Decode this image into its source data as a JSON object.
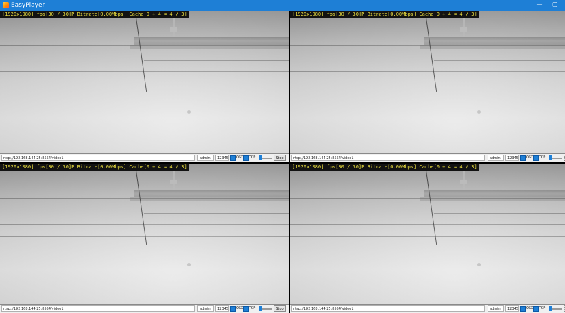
{
  "window": {
    "title": "EasyPlayer",
    "minimize_glyph": "—",
    "maximize_glyph": "▢"
  },
  "panes": [
    {
      "osd_text": "[1920x1080] fps[30 / 30]P Bitrate[0.00Mbps] Cache[0 + 4 = 4 / 3]",
      "url": "rtsp://192.168.144.25:8554/video1",
      "username": "admin",
      "password": "12345",
      "osd_label": "OSD",
      "tcp_label": "TCP",
      "stop_label": "Stop"
    },
    {
      "osd_text": "[1920x1080] fps[30 / 30]P Bitrate[0.00Mbps] Cache[0 + 4 = 4 / 3]",
      "url": "rtsp://192.168.144.25:8554/video1",
      "username": "admin",
      "password": "12345",
      "osd_label": "OSD",
      "tcp_label": "TCP",
      "stop_label": "St"
    },
    {
      "osd_text": "[1920x1080] fps[30 / 30]P Bitrate[0.00Mbps] Cache[0 + 4 = 4 / 3]",
      "url": "rtsp://192.168.144.25:8554/video1",
      "username": "admin",
      "password": "12345",
      "osd_label": "OSD",
      "tcp_label": "TCP",
      "stop_label": "Stop"
    },
    {
      "osd_text": "[1920x1080] fps[30 / 30]P Bitrate[0.00Mbps] Cache[0 + 4 = 4 / 3]",
      "url": "rtsp://192.168.144.25:8554/video1",
      "username": "admin",
      "password": "12345",
      "osd_label": "OSD",
      "tcp_label": "TCP",
      "stop_label": "St"
    }
  ],
  "colors": {
    "titlebar": "#1e7fd6",
    "osd_text": "#f0e442",
    "checkbox": "#1e7fd6"
  }
}
